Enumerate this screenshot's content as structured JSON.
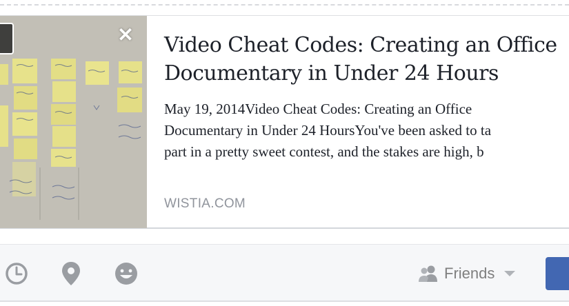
{
  "link_preview": {
    "title": "Video Cheat Codes: Creating an Office Documentary in Under 24 Hours",
    "title_line1": "Video Cheat Codes: Creating an Office",
    "title_line2": "Documentary in Under 24 Hours",
    "description_line1": "May 19, 2014Video Cheat Codes: Creating an Office",
    "description_line2": "Documentary in Under 24 HoursYou've been asked to ta",
    "description_line3": "part in a pretty sweet contest, and the stakes are high, b",
    "domain": "WISTIA.COM",
    "thumbnail_icon": "sticky-notes-photo",
    "remove_icon": "close-icon"
  },
  "composer": {
    "tools": [
      {
        "icon": "clock-icon"
      },
      {
        "icon": "location-pin-icon"
      },
      {
        "icon": "smiley-icon"
      }
    ],
    "audience": {
      "icon": "friends-icon",
      "label": "Friends",
      "dropdown_icon": "chevron-down-icon"
    },
    "post_button_color": "#4267b2"
  },
  "colors": {
    "text": "#1d2129",
    "muted": "#90949c",
    "icon_gray": "#9a9da2",
    "bar_bg": "#f6f7f9"
  }
}
